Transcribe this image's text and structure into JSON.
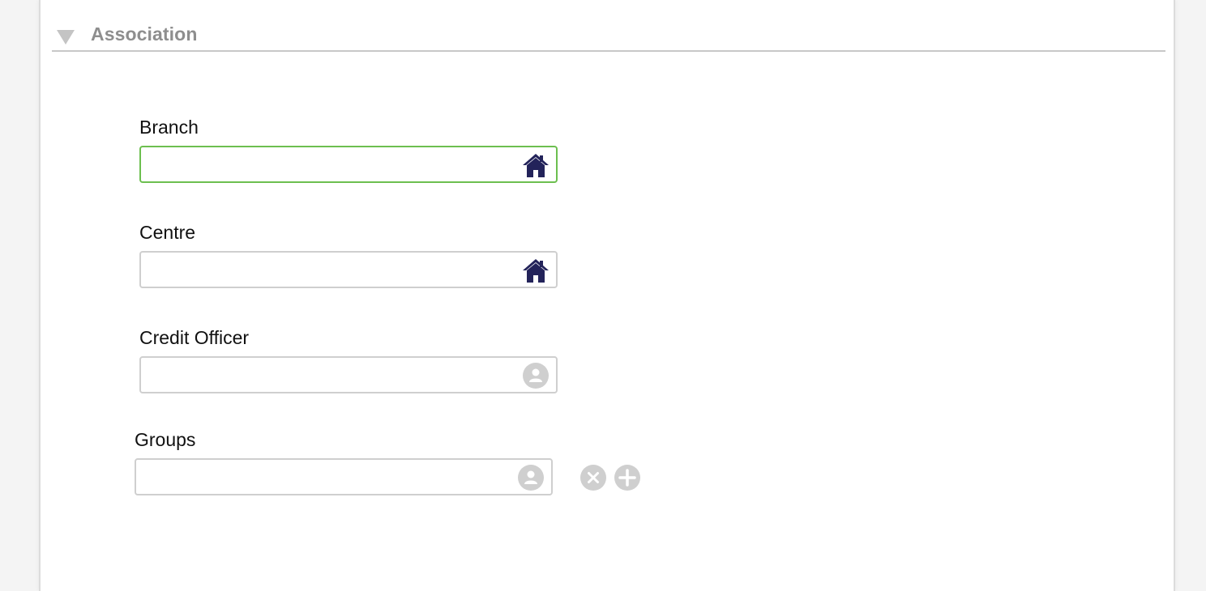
{
  "section": {
    "title": "Association",
    "toggle_icon": "triangle-down-icon"
  },
  "fields": {
    "branch": {
      "label": "Branch",
      "value": "",
      "icon": "house-icon",
      "focused": true
    },
    "centre": {
      "label": "Centre",
      "value": "",
      "icon": "house-icon"
    },
    "credit_officer": {
      "label": "Credit Officer",
      "value": "",
      "icon": "user-icon"
    },
    "groups": {
      "label": "Groups",
      "value": "",
      "icon": "user-icon",
      "remove_icon": "remove-circle-icon",
      "add_icon": "add-circle-icon"
    }
  },
  "colors": {
    "focus_border": "#6cbf4f",
    "house_icon": "#23235a",
    "muted_icon": "#cfcfcf",
    "header_text": "#8e8e8e"
  }
}
